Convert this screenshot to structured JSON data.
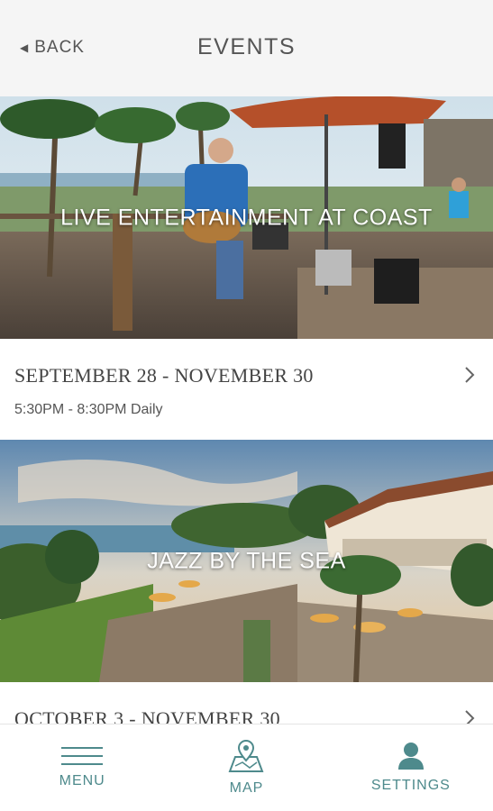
{
  "header": {
    "back_label": "BACK",
    "title": "EVENTS"
  },
  "events": [
    {
      "title": "LIVE ENTERTAINMENT AT COAST",
      "dates": "SEPTEMBER 28 - NOVEMBER 30",
      "time": "5:30PM - 8:30PM Daily"
    },
    {
      "title": "JAZZ BY THE SEA",
      "dates": "OCTOBER 3 - NOVEMBER 30"
    }
  ],
  "bottom_nav": {
    "menu_label": "MENU",
    "map_label": "MAP",
    "settings_label": "SETTINGS"
  },
  "colors": {
    "accent": "#4e8a8c",
    "header_bg": "#f5f5f5",
    "text_gray": "#555555"
  }
}
